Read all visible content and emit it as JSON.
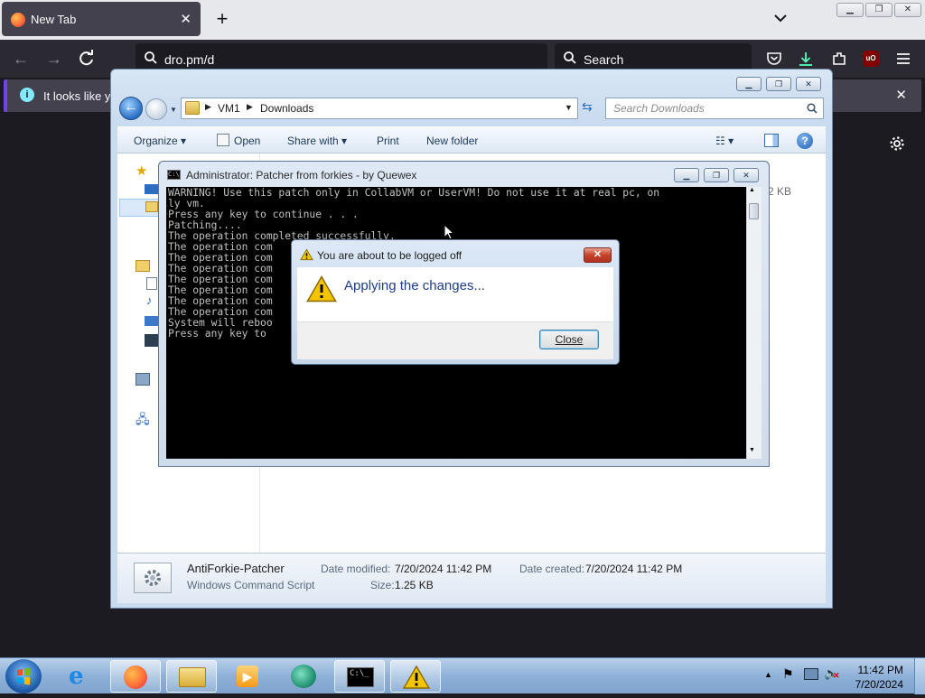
{
  "browser": {
    "tab_title": "New Tab",
    "tab_close": "✕",
    "new_tab": "+",
    "url": "dro.pm/d",
    "search_placeholder": "Search",
    "infobar_text": "It looks like you",
    "infobar_close": "✕"
  },
  "explorer": {
    "breadcrumb": [
      "VM1",
      "Downloads"
    ],
    "search_placeholder": "Search Downloads",
    "commands": [
      "Organize ▾",
      "Open",
      "Share with ▾",
      "Print",
      "New folder"
    ],
    "size_fragment": "2 KB",
    "details": {
      "name": "AntiForkie-Patcher",
      "type": "Windows Command Script",
      "modified_label": "Date modified:",
      "modified_value": "7/20/2024 11:42 PM",
      "created_label": "Date created:",
      "created_value": "7/20/2024 11:42 PM",
      "size_label": "Size:",
      "size_value": "1.25 KB"
    }
  },
  "cmd": {
    "title": "Administrator:  Patcher from forkies - by Quewex",
    "lines": [
      "WARNING! Use this patch only in CollabVM or UserVM! Do not use it at real pc, on",
      "ly vm.",
      "Press any key to continue . . .",
      "Patching....",
      "The operation completed successfully.",
      "The operation com",
      "The operation com",
      "The operation com",
      "The operation com",
      "The operation com",
      "The operation com",
      "The operation com",
      "System will reboo",
      "Press any key to "
    ]
  },
  "dialog": {
    "title": "You are about to be logged off",
    "message": "Applying the changes...",
    "close_button": "Close"
  },
  "taskbar": {
    "time": "11:42 PM",
    "date": "7/20/2024"
  },
  "colors": {
    "firefox_dark": "#2b2a33",
    "explorer_frame": "#c9dbef",
    "console_bg": "#000000",
    "dialog_message": "#1e3c8c",
    "taskbar": "#8fb1d8"
  }
}
